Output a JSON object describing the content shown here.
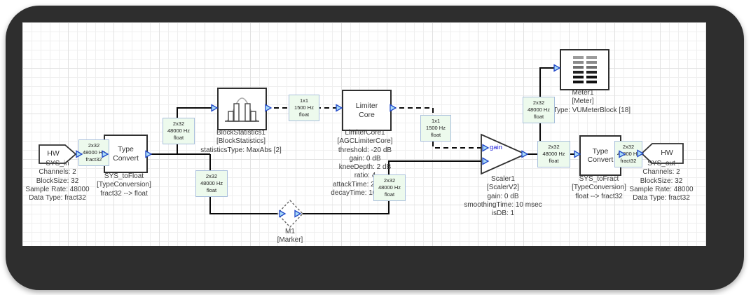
{
  "palette": {
    "frame": "#2e2e2e",
    "wire": "#0a0a0a",
    "wire_label_bg": "#edfaed",
    "wire_label_border": "#a9bfdc",
    "pin_fill": "#aadcf7",
    "pin_stroke": "#1f46c8",
    "gain_text": "#1f1fd8"
  },
  "blocks": {
    "sys_in": {
      "hw_label": "HW",
      "caption": "SYS_in\nChannels: 2\nBlockSize: 32\nSample Rate: 48000\nData Type: fract32"
    },
    "sys_to_float": {
      "label": "Type\nConvert",
      "caption": "SYS_toFloat\n[TypeConversion]\nfract32 --> float"
    },
    "block_statistics": {
      "caption": "BlockStatistics1\n[BlockStatistics]\nstatisticsType: MaxAbs [2]"
    },
    "limiter_core": {
      "label": "Limiter\nCore",
      "caption": "LimiterCore1\n[AGCLimiterCore]\nthreshold: -20 dB\ngain: 0 dB\nkneeDepth: 2 dB\nratio: 4\nattackTime: 20 msec\ndecayTime: 100 msec"
    },
    "marker": {
      "caption": "M1\n[Marker]"
    },
    "scaler": {
      "gain_pin_label": "gain",
      "caption": "Scaler1\n[ScalerV2]\ngain: 0 dB\nsmoothingTime: 10 msec\nisDB: 1"
    },
    "meter": {
      "caption": "Meter1\n[Meter]\nmeterType: VUMeterBlock [18]"
    },
    "sys_to_fract": {
      "label": "Type\nConvert",
      "caption": "SYS_toFract\n[TypeConversion]\nfloat --> fract32"
    },
    "sys_out": {
      "hw_label": "HW",
      "caption": "SYS_out\nChannels: 2\nBlockSize: 32\nSample Rate: 48000\nData Type: fract32"
    }
  },
  "wire_labels": {
    "in_fract": "2x32\n48000 Hz\nfract32",
    "stats_branch": "2x32\n48000 Hz\nfloat",
    "main_branch": "2x32\n48000 Hz\nfloat",
    "to_scaler": "2x32\n48000 Hz\nfloat",
    "stats_to_limiter": "1x1\n1500 Hz\nfloat",
    "limiter_to_scaler": "1x1\n1500 Hz\nfloat",
    "to_meter": "2x32\n48000 Hz\nfloat",
    "scaler_out": "2x32\n48000 Hz\nfloat",
    "out_fract": "2x32\n48000 Hz\nfract32"
  }
}
